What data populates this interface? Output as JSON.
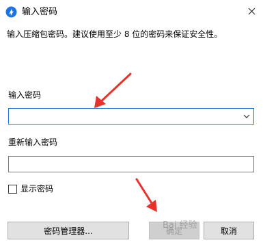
{
  "window": {
    "title": "输入密码",
    "close_glyph": "✕"
  },
  "description": "输入压缩包密码。建议使用至少 8 位的密码来保证安全性。",
  "password_field": {
    "label": "输入密码",
    "value": ""
  },
  "repeat_field": {
    "label": "重新输入密码",
    "value": ""
  },
  "show_password": {
    "label": "显示密码",
    "checked": false
  },
  "buttons": {
    "manager": "密码管理器...",
    "ok": "确定",
    "cancel": "取消"
  },
  "watermark": "Bai 经验",
  "colors": {
    "focus_border": "#1e7ad6",
    "annotation_arrow": "#e8312a",
    "app_icon": "#1a73e8"
  },
  "icons": {
    "app": "bandizip-app-icon",
    "close": "close-icon",
    "dropdown": "chevron-down-icon"
  }
}
